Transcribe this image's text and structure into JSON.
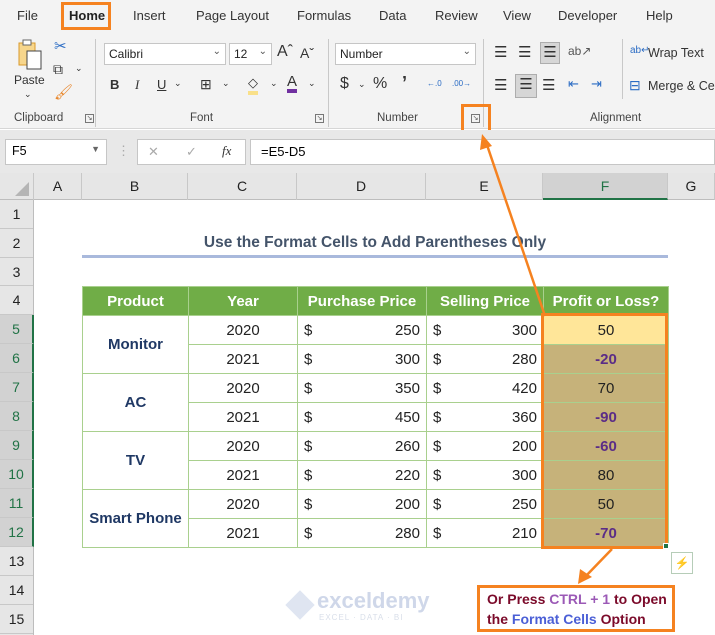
{
  "ribbon": {
    "tabs": [
      "File",
      "Home",
      "Insert",
      "Page Layout",
      "Formulas",
      "Data",
      "Review",
      "View",
      "Developer",
      "Help"
    ],
    "active_tab": "Home",
    "groups": {
      "clipboard": {
        "label": "Clipboard",
        "paste_label": "Paste"
      },
      "font": {
        "label": "Font",
        "font_name": "Calibri",
        "font_size": "12",
        "bold": "B",
        "italic": "I",
        "underline": "U",
        "grow": "Aˆ",
        "shrink": "Aˇ",
        "font_color_glyph": "A"
      },
      "number": {
        "label": "Number",
        "format": "Number",
        "currency": "$",
        "percent": "%",
        "comma": "’",
        "inc_decimal": "←.0",
        "dec_decimal": ".00→"
      },
      "alignment": {
        "label": "Alignment",
        "wrap_text": "Wrap Text",
        "merge_center": "Merge & Center"
      }
    }
  },
  "formula_bar": {
    "name_box": "F5",
    "fx": "fx",
    "cancel": "✕",
    "enter": "✓",
    "formula": "=E5-D5"
  },
  "sheet": {
    "columns": [
      "A",
      "B",
      "C",
      "D",
      "E",
      "F",
      "G"
    ],
    "selected_column": "F",
    "rows": [
      "1",
      "2",
      "3",
      "4",
      "5",
      "6",
      "7",
      "8",
      "9",
      "10",
      "11",
      "12",
      "13",
      "14",
      "15"
    ],
    "selected_rows": [
      "5",
      "6",
      "7",
      "8",
      "9",
      "10",
      "11",
      "12"
    ],
    "title": "Use the Format Cells to Add Parentheses Only",
    "table": {
      "headers": [
        "Product",
        "Year",
        "Purchase Price",
        "Selling Price",
        "Profit or Loss?"
      ],
      "currency_symbol": "$",
      "products": [
        "Monitor",
        "AC",
        "TV",
        "Smart Phone"
      ],
      "rows": [
        {
          "year": "2020",
          "purchase": "250",
          "selling": "300",
          "profit": "50"
        },
        {
          "year": "2021",
          "purchase": "300",
          "selling": "280",
          "profit": "-20"
        },
        {
          "year": "2020",
          "purchase": "350",
          "selling": "420",
          "profit": "70"
        },
        {
          "year": "2021",
          "purchase": "450",
          "selling": "360",
          "profit": "-90"
        },
        {
          "year": "2020",
          "purchase": "260",
          "selling": "200",
          "profit": "-60"
        },
        {
          "year": "2021",
          "purchase": "220",
          "selling": "300",
          "profit": "80"
        },
        {
          "year": "2020",
          "purchase": "200",
          "selling": "250",
          "profit": "50"
        },
        {
          "year": "2021",
          "purchase": "280",
          "selling": "210",
          "profit": "-70"
        }
      ]
    }
  },
  "callout": {
    "line1_a": "Or Press ",
    "line1_b": "CTRL + 1",
    "line1_c": " to Open",
    "line2_a": "the ",
    "line2_b": "Format Cells",
    "line2_c": " Option"
  },
  "watermark": {
    "name": "exceldemy",
    "tagline": "EXCEL · DATA · BI"
  },
  "colors": {
    "accent_orange": "#f58220",
    "header_green": "#70ad47",
    "selected_fill": "#c6b27a",
    "active_cell_fill": "#ffe699",
    "negative_text": "#5b2c87"
  }
}
